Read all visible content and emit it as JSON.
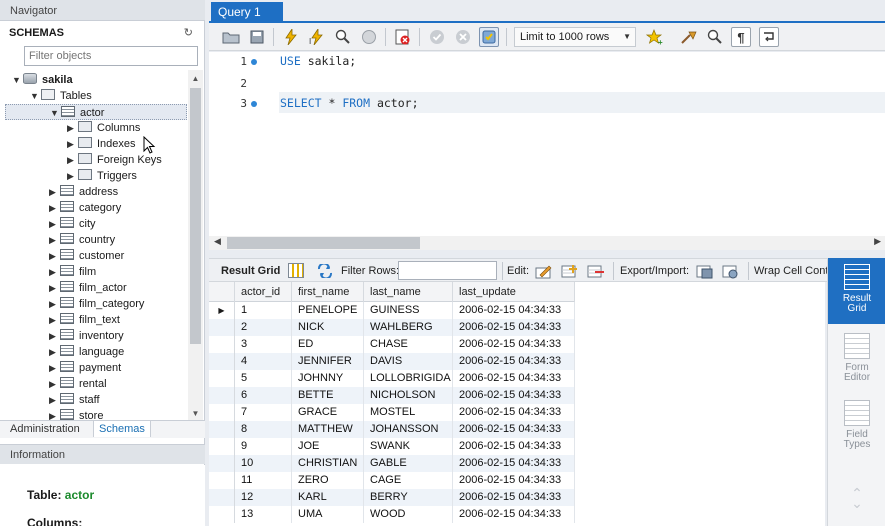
{
  "navigator": {
    "title": "Navigator",
    "schemas_label": "SCHEMAS",
    "refresh_icon": "↻",
    "filter_placeholder": "Filter objects",
    "tree": [
      {
        "label": "sakila",
        "icon": "database-icon"
      },
      {
        "label": "Tables",
        "icon": "folder-icon"
      },
      {
        "label": "actor",
        "icon": "table-icon"
      },
      {
        "label": "Columns",
        "icon": "columns-icon"
      },
      {
        "label": "Indexes",
        "icon": "indexes-icon"
      },
      {
        "label": "Foreign Keys",
        "icon": "foreign-keys-icon"
      },
      {
        "label": "Triggers",
        "icon": "triggers-icon"
      },
      {
        "label": "address",
        "icon": "table-icon"
      },
      {
        "label": "category",
        "icon": "table-icon"
      },
      {
        "label": "city",
        "icon": "table-icon"
      },
      {
        "label": "country",
        "icon": "table-icon"
      },
      {
        "label": "customer",
        "icon": "table-icon"
      },
      {
        "label": "film",
        "icon": "table-icon"
      },
      {
        "label": "film_actor",
        "icon": "table-icon"
      },
      {
        "label": "film_category",
        "icon": "table-icon"
      },
      {
        "label": "film_text",
        "icon": "table-icon"
      },
      {
        "label": "inventory",
        "icon": "table-icon"
      },
      {
        "label": "language",
        "icon": "table-icon"
      },
      {
        "label": "payment",
        "icon": "table-icon"
      },
      {
        "label": "rental",
        "icon": "table-icon"
      },
      {
        "label": "staff",
        "icon": "table-icon"
      },
      {
        "label": "store",
        "icon": "table-icon"
      }
    ],
    "tabs": {
      "administration": "Administration",
      "schemas": "Schemas"
    },
    "info": {
      "title": "Information",
      "table_label": "Table:",
      "table_value": "actor",
      "columns_label": "Columns:"
    }
  },
  "editor": {
    "tab_title": "Query 1",
    "tab_close": "×",
    "limit_label": "Limit to 1000 rows",
    "lines": [
      {
        "num": "1",
        "kw": "USE",
        "rest": " sakila;"
      },
      {
        "num": "2",
        "kw": "",
        "rest": ""
      },
      {
        "num": "3",
        "kw": "SELECT",
        "rest": " * ",
        "kw2": "FROM",
        "rest2": " actor;"
      }
    ]
  },
  "result_toolbar": {
    "result_grid": "Result Grid",
    "filter_rows": "Filter Rows:",
    "edit": "Edit:",
    "export_import": "Export/Import:",
    "wrap": "Wrap Cell Conte"
  },
  "grid": {
    "columns": [
      "actor_id",
      "first_name",
      "last_name",
      "last_update"
    ],
    "rows": [
      [
        "1",
        "PENELOPE",
        "GUINESS",
        "2006-02-15 04:34:33"
      ],
      [
        "2",
        "NICK",
        "WAHLBERG",
        "2006-02-15 04:34:33"
      ],
      [
        "3",
        "ED",
        "CHASE",
        "2006-02-15 04:34:33"
      ],
      [
        "4",
        "JENNIFER",
        "DAVIS",
        "2006-02-15 04:34:33"
      ],
      [
        "5",
        "JOHNNY",
        "LOLLOBRIGIDA",
        "2006-02-15 04:34:33"
      ],
      [
        "6",
        "BETTE",
        "NICHOLSON",
        "2006-02-15 04:34:33"
      ],
      [
        "7",
        "GRACE",
        "MOSTEL",
        "2006-02-15 04:34:33"
      ],
      [
        "8",
        "MATTHEW",
        "JOHANSSON",
        "2006-02-15 04:34:33"
      ],
      [
        "9",
        "JOE",
        "SWANK",
        "2006-02-15 04:34:33"
      ],
      [
        "10",
        "CHRISTIAN",
        "GABLE",
        "2006-02-15 04:34:33"
      ],
      [
        "11",
        "ZERO",
        "CAGE",
        "2006-02-15 04:34:33"
      ],
      [
        "12",
        "KARL",
        "BERRY",
        "2006-02-15 04:34:33"
      ],
      [
        "13",
        "UMA",
        "WOOD",
        "2006-02-15 04:34:33"
      ]
    ]
  },
  "side_panel": {
    "result_grid": "Result Grid",
    "form_editor": "Form Editor",
    "field_types": "Field Types"
  },
  "colors": {
    "accent": "#1e6fc4",
    "info_table_value": "#1b8a2c"
  }
}
